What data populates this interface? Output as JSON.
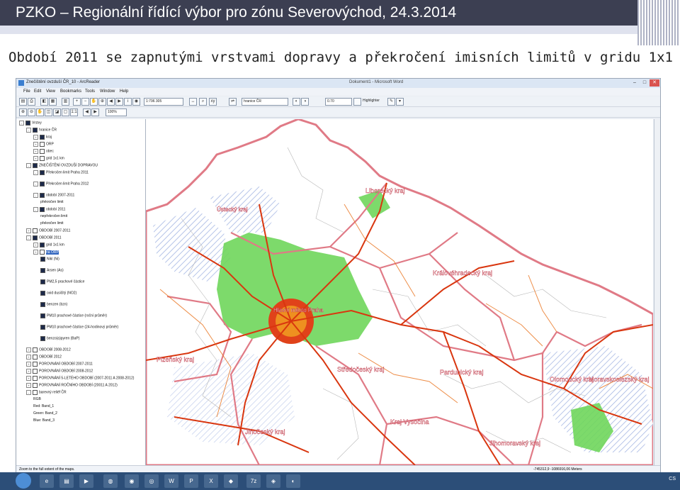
{
  "slide": {
    "title": "PZKO – Regionální řídící výbor pro zónu Severovýchod, 24.3.2014",
    "subtitle": "Období 2011 se zapnutými vrstvami dopravy a překročení imisních limitů v gridu 1x1 km"
  },
  "app": {
    "window_title": "Znečištění ovzduší ČR_10 - ArcReader",
    "title_right": "Dokument1 - Microsoft Word",
    "menu": [
      "File",
      "Edit",
      "View",
      "Bookmarks",
      "Tools",
      "Window",
      "Help"
    ],
    "scale_value": "1:796 305",
    "layer_select": "hranice ČR",
    "transparency_value": "0.70",
    "highlighter_label": "Highlighter",
    "zoom_value": "100%",
    "status_left": "Zoom to the full extent of the maps.",
    "status_coords": "-745312,9  -1086916,06 Meters"
  },
  "toc": [
    {
      "label": "Vrstvy",
      "indent": 0,
      "expand": "-",
      "checked": true
    },
    {
      "label": "hranice ČR",
      "indent": 1,
      "expand": "-",
      "checked": true
    },
    {
      "label": "kraj",
      "indent": 2,
      "expand": "+",
      "checked": true
    },
    {
      "label": "ORP",
      "indent": 2,
      "expand": "+",
      "checked": false
    },
    {
      "label": "obec",
      "indent": 2,
      "expand": "+",
      "checked": false
    },
    {
      "label": "grid 1x1 km",
      "indent": 2,
      "expand": "+",
      "checked": false
    },
    {
      "label": "ZNEČIŠTĚNÍ OVZDUŠÍ DOPRAVOU",
      "indent": 1,
      "expand": "-",
      "checked": true
    },
    {
      "label": "Překročen limit Praha 2011",
      "indent": 2,
      "expand": "-",
      "checked": true
    },
    {
      "label": "Překročen limit Praha 2012",
      "indent": 2,
      "expand": "-",
      "checked": true
    },
    {
      "label": "období 2007-2011",
      "indent": 2,
      "expand": "-",
      "checked": true
    },
    {
      "label": "překročen limit",
      "indent": 3,
      "expand": "",
      "checked": null
    },
    {
      "label": "období 2011",
      "indent": 2,
      "expand": "-",
      "checked": true
    },
    {
      "label": "nepřekročen limit",
      "indent": 3,
      "expand": "",
      "checked": null
    },
    {
      "label": "překročen limit",
      "indent": 3,
      "expand": "",
      "checked": null
    },
    {
      "label": "OBDOBÍ 2007-2011",
      "indent": 1,
      "expand": "+",
      "checked": false
    },
    {
      "label": "OBDOBÍ 2011",
      "indent": 1,
      "expand": "-",
      "checked": true
    },
    {
      "label": "grid 1x1 km",
      "indent": 2,
      "expand": "+",
      "checked": true
    },
    {
      "label": "na ORP",
      "indent": 2,
      "expand": "+",
      "checked": false,
      "highlight": true
    },
    {
      "label": "Nikl (Ni)",
      "indent": 3,
      "expand": "",
      "checked": true
    },
    {
      "label": "Arsen (As)",
      "indent": 3,
      "expand": "",
      "checked": true
    },
    {
      "label": "PM2,5 prachové částice",
      "indent": 3,
      "expand": "",
      "checked": true
    },
    {
      "label": "oxid dusičitý (NO2)",
      "indent": 3,
      "expand": "",
      "checked": true
    },
    {
      "label": "benzen (bzn)",
      "indent": 3,
      "expand": "",
      "checked": true
    },
    {
      "label": "PM10 prachové částice (roční průměr)",
      "indent": 3,
      "expand": "",
      "checked": true
    },
    {
      "label": "PM10 prachové částice (24-hodinový průměr)",
      "indent": 3,
      "expand": "",
      "checked": true
    },
    {
      "label": "benzo(a)pyren (BaP)",
      "indent": 3,
      "expand": "",
      "checked": true
    },
    {
      "label": "OBDOBÍ 2008-2012",
      "indent": 1,
      "expand": "+",
      "checked": false
    },
    {
      "label": "OBDOBÍ 2012",
      "indent": 1,
      "expand": "+",
      "checked": false
    },
    {
      "label": "POROVNÁNÍ OBDOBÍ 2007-2011",
      "indent": 1,
      "expand": "+",
      "checked": false
    },
    {
      "label": "POROVNÁNÍ OBDOBÍ 2008-2012",
      "indent": 1,
      "expand": "+",
      "checked": false
    },
    {
      "label": "POROVNÁNÍ 5-LETÉHO OBDOBÍ (2007-2011 A 2008-2012)",
      "indent": 1,
      "expand": "+",
      "checked": false
    },
    {
      "label": "POROVNÁNÍ ROČNÍHO OBDOBÍ (20011 A 2012)",
      "indent": 1,
      "expand": "+",
      "checked": false
    },
    {
      "label": "barevný reliéf ČR",
      "indent": 1,
      "expand": "-",
      "checked": false
    },
    {
      "label": "RGB",
      "indent": 2,
      "expand": "",
      "checked": null
    },
    {
      "label": "Red:   Band_1",
      "indent": 2,
      "expand": "",
      "checked": null
    },
    {
      "label": "Green: Band_2",
      "indent": 2,
      "expand": "",
      "checked": null
    },
    {
      "label": "Blue:  Band_3",
      "indent": 2,
      "expand": "",
      "checked": null
    }
  ],
  "map_labels": [
    "Liberecký kraj",
    "Ústecký kraj",
    "Královéhradecký kraj",
    "Hlavní město Praha",
    "Plzeňský kraj",
    "Středočeský kraj",
    "Pardubický kraj",
    "Olomoucký kraj",
    "Moravskoslezský kraj",
    "Kraj Vysočina",
    "Jihočeský kraj",
    "Jihomoravský kraj"
  ],
  "colors": {
    "exceeded_area": "#6fd65b",
    "region_border": "#e07a86",
    "roads": "#d9360f",
    "header_bg": "#3c3f52"
  },
  "taskbar": {
    "tray_text": "CS"
  }
}
